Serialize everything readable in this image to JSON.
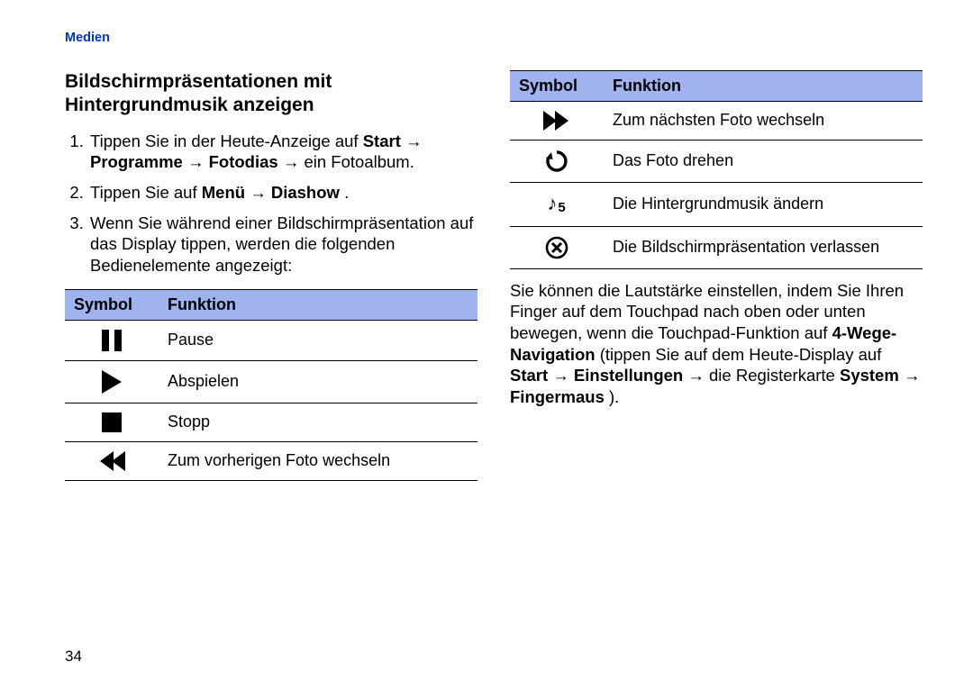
{
  "section_label": "Medien",
  "title": "Bildschirmpräsentationen mit Hintergrundmusik anzeigen",
  "steps": [
    {
      "pre": "Tippen Sie in der Heute-Anzeige auf ",
      "bold": "Start → Programme → Fotodias →",
      "post": " ein Fotoalbum."
    },
    {
      "pre": "Tippen Sie auf ",
      "bold": "Menü → Diashow",
      "post": "."
    },
    {
      "pre": "Wenn Sie während einer Bildschirmpräsentation auf das Display tippen, werden die folgenden Bedienelemente angezeigt:",
      "bold": "",
      "post": ""
    }
  ],
  "tbl_headers": {
    "symbol": "Symbol",
    "funktion": "Funktion"
  },
  "table_left": [
    {
      "icon": "pause-icon",
      "text": "Pause"
    },
    {
      "icon": "play-icon",
      "text": "Abspielen"
    },
    {
      "icon": "stop-icon",
      "text": "Stopp"
    },
    {
      "icon": "rewind-icon",
      "text": "Zum vorherigen Foto wechseln"
    }
  ],
  "table_right": [
    {
      "icon": "forward-icon",
      "text": "Zum nächsten Foto wechseln"
    },
    {
      "icon": "rotate-icon",
      "text": "Das Foto drehen"
    },
    {
      "icon": "music-icon",
      "text": "Die Hintergrundmusik ändern"
    },
    {
      "icon": "close-icon",
      "text": "Die Bildschirmpräsentation verlassen"
    }
  ],
  "music_icon_label": "♪5",
  "volume_para": {
    "t1": "Sie können die Lautstärke einstellen, indem Sie Ihren Finger auf dem Touchpad nach oben oder unten bewegen, wenn die Touchpad-Funktion auf ",
    "b1": "4-Wege-Navigation",
    "t2": " (tippen Sie auf dem Heute-Display auf ",
    "b2": "Start → Einstellungen →",
    "t3": " die Registerkarte ",
    "b3": "System →",
    "t4": " ",
    "b4": "Fingermaus",
    "t5": ")."
  },
  "page_number": "34"
}
